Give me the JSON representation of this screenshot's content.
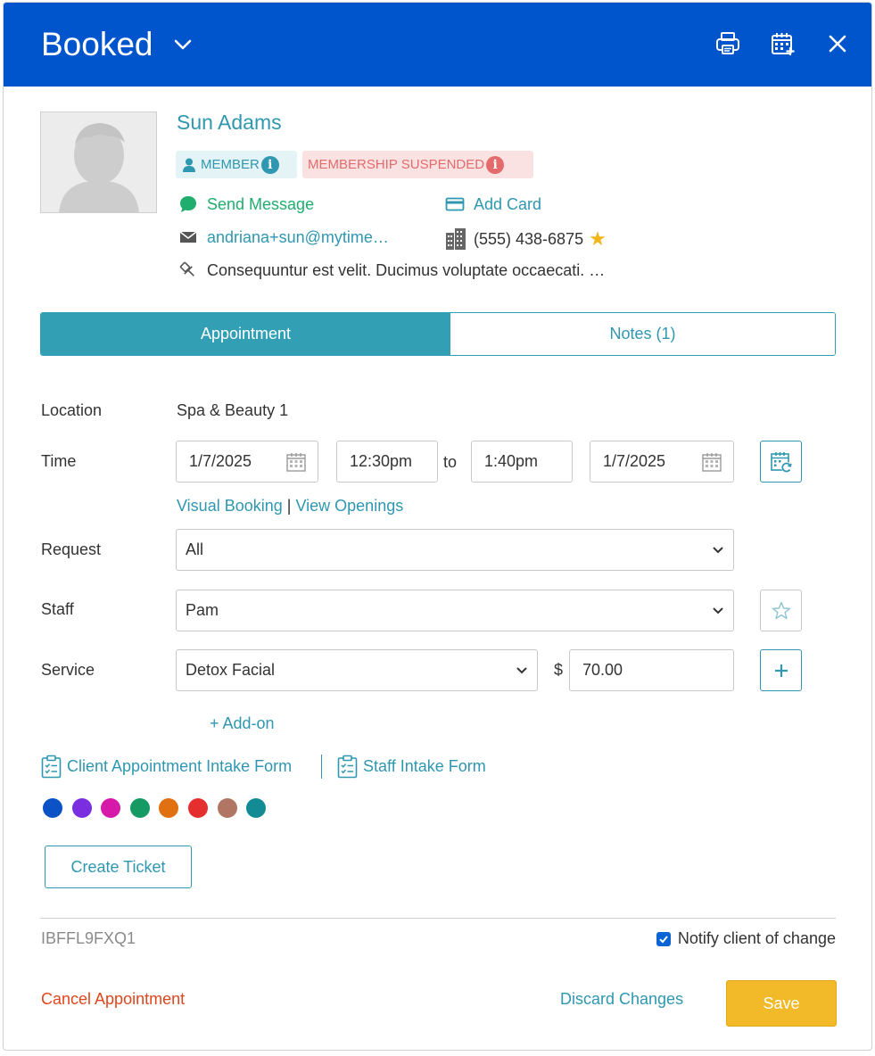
{
  "header": {
    "title": "Booked",
    "icons": [
      "chevron-down-icon",
      "print-icon",
      "calendar-add-icon",
      "close-icon"
    ]
  },
  "client": {
    "name": "Sun Adams",
    "member_badge": "MEMBER",
    "suspended_badge": "MEMBERSHIP SUSPENDED",
    "send_message": "Send Message",
    "add_card": "Add Card",
    "email": "andriana+sun@mytime…",
    "phone": "(555) 438-6875",
    "note": "Consequuntur est velit. Ducimus voluptate occaecati. …"
  },
  "tabs": [
    {
      "label": "Appointment",
      "active": true
    },
    {
      "label": "Notes (1)",
      "active": false
    }
  ],
  "form": {
    "location_label": "Location",
    "location_value": "Spa & Beauty 1",
    "time_label": "Time",
    "start_date": "1/7/2025",
    "start_time": "12:30pm",
    "to_text": "to",
    "end_time": "1:40pm",
    "end_date": "1/7/2025",
    "visual_booking": "Visual Booking",
    "separator": "|",
    "view_openings": "View Openings",
    "request_label": "Request",
    "request_value": "All",
    "staff_label": "Staff",
    "staff_value": "Pam",
    "service_label": "Service",
    "service_value": "Detox Facial",
    "currency": "$",
    "price": "70.00",
    "add_on": "+ Add-on",
    "client_intake": "Client Appointment Intake Form",
    "staff_intake": "Staff Intake Form"
  },
  "colors": [
    "#0a52c6",
    "#7b2ee0",
    "#d619a8",
    "#159a63",
    "#e07010",
    "#e52e2e",
    "#b07563",
    "#128b94"
  ],
  "accent": "#2f97b0",
  "header_color": "#0055cc",
  "create_ticket": "Create Ticket",
  "footer": {
    "ref_code": "IBFFL9FXQ1",
    "notify_label": "Notify client of change",
    "notify_checked": true,
    "cancel": "Cancel Appointment",
    "discard": "Discard Changes",
    "save": "Save"
  }
}
